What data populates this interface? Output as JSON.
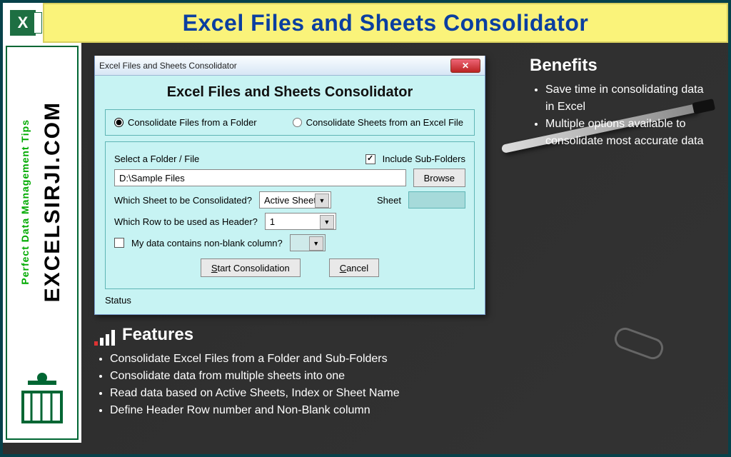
{
  "header": {
    "title": "Excel Files and Sheets Consolidator"
  },
  "sidebar": {
    "brand": "EXCELSIRJI.COM",
    "tagline": "Perfect Data Management Tips"
  },
  "dialog": {
    "window_title": "Excel Files and Sheets Consolidator",
    "heading": "Excel Files and Sheets Consolidator",
    "radio_folder": "Consolidate Files from a Folder",
    "radio_sheets": "Consolidate Sheets from an Excel File",
    "select_label": "Select a Folder / File",
    "include_sub": "Include Sub-Folders",
    "path_value": "D:\\Sample Files",
    "browse": "Browse",
    "which_sheet_label": "Which Sheet to be Consolidated?",
    "which_sheet_value": "Active Sheet",
    "sheet_label": "Sheet",
    "which_row_label": "Which Row to be used as Header?",
    "which_row_value": "1",
    "nonblank_label": "My data contains non-blank column?",
    "start": "Start Consolidation",
    "cancel": "Cancel",
    "status_label": "Status"
  },
  "benefits": {
    "title": "Benefits",
    "items": [
      "Save time in consolidating data in Excel",
      "Multiple options available to consolidate most accurate data"
    ]
  },
  "features": {
    "title": "Features",
    "items": [
      "Consolidate Excel Files from a Folder and Sub-Folders",
      "Consolidate data from multiple sheets into one",
      "Read data based on Active Sheets, Index or Sheet Name",
      "Define Header Row number and Non-Blank column"
    ]
  }
}
